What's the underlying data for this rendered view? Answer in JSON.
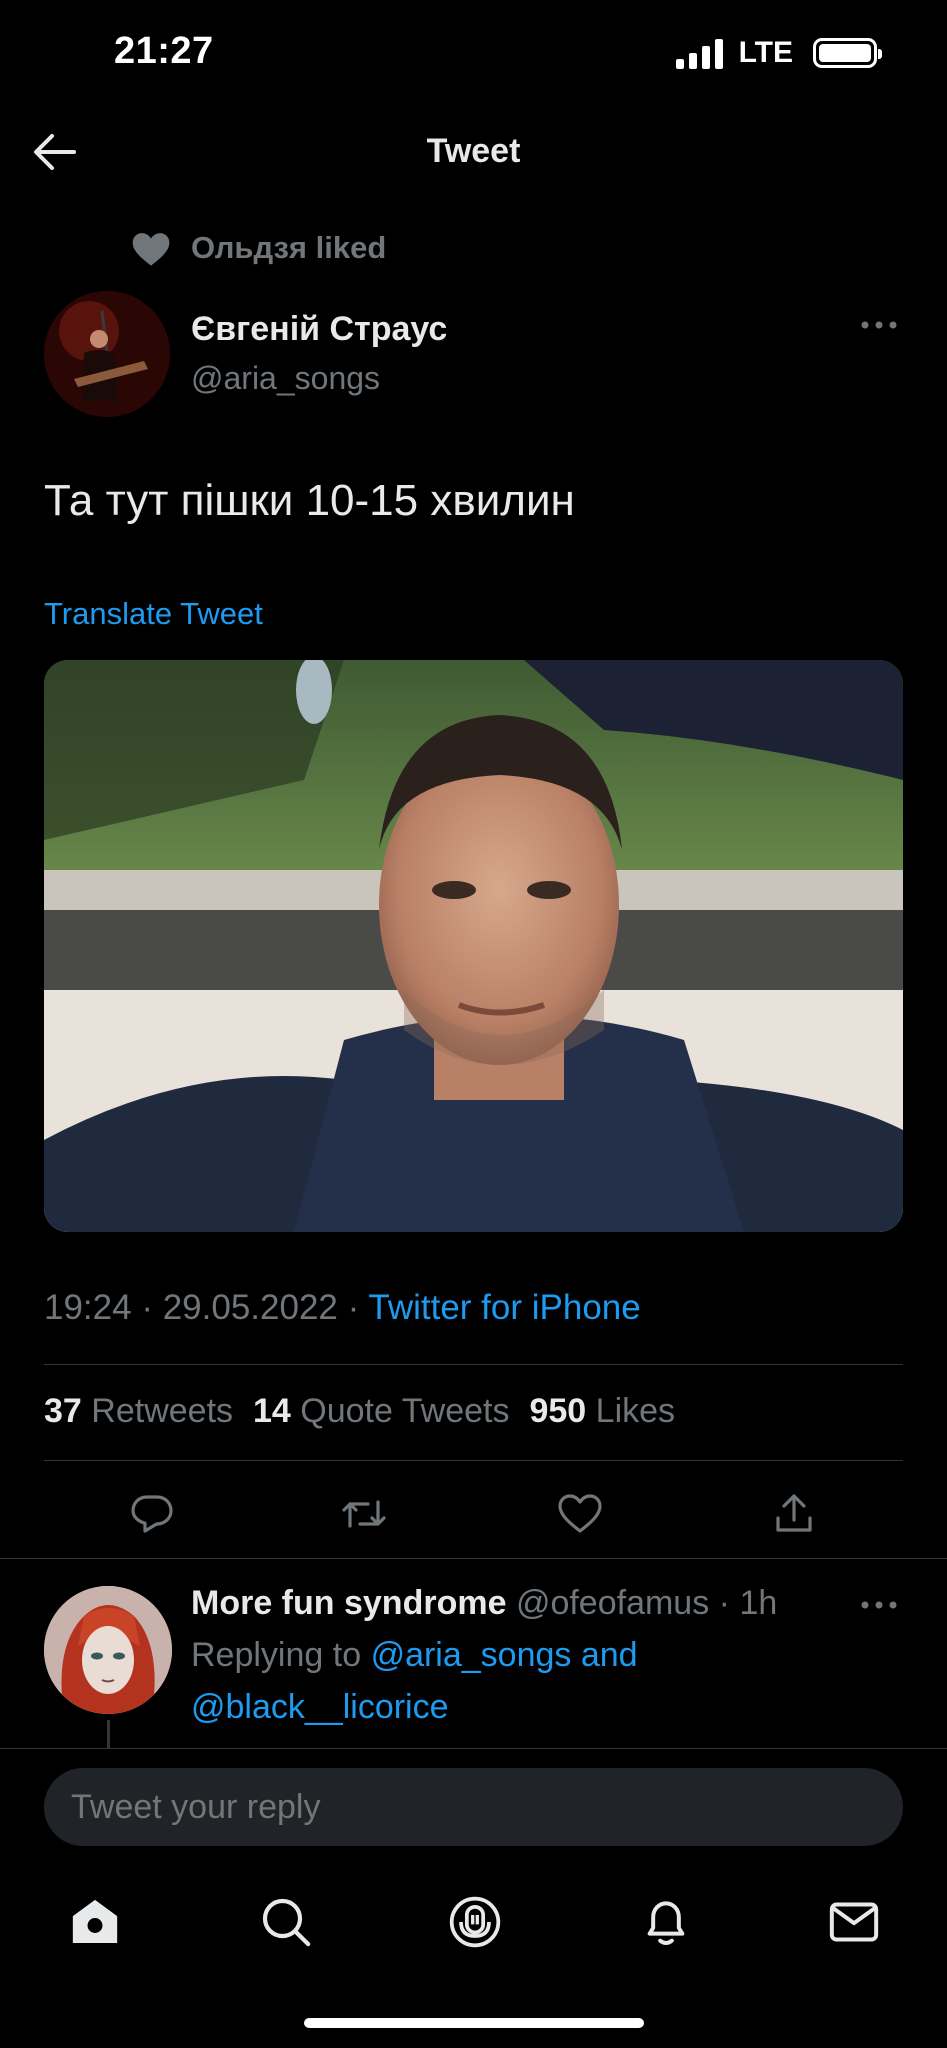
{
  "status_bar": {
    "time": "21:27",
    "network": "LTE"
  },
  "header": {
    "title": "Tweet"
  },
  "social_context": {
    "text": "Ольдзя liked"
  },
  "tweet": {
    "author_name": "Євгеній Страус",
    "author_handle": "@aria_songs",
    "text": "Та тут пішки 10-15 хвилин",
    "translate_label": "Translate Tweet",
    "time": "19:24",
    "date": "29.05.2022",
    "source": "Twitter for iPhone",
    "retweets_count": "37",
    "retweets_label": "Retweets",
    "quote_count": "14",
    "quote_label": "Quote Tweets",
    "likes_count": "950",
    "likes_label": "Likes"
  },
  "reply": {
    "name": "More fun syndrome",
    "handle": "@ofeofamus",
    "age": "1h",
    "replying_prefix": "Replying to",
    "replying_to_1": "@aria_songs and",
    "replying_to_2": "@black__licorice"
  },
  "compose": {
    "placeholder": "Tweet your reply"
  },
  "icons": {
    "back": "arrow-left-icon",
    "liked": "heart-filled-icon",
    "more": "more-horizontal-icon",
    "actions": [
      "reply-icon",
      "retweet-icon",
      "like-icon",
      "share-icon"
    ],
    "nav": [
      "home-icon",
      "search-icon",
      "spaces-icon",
      "notifications-icon",
      "messages-icon"
    ]
  },
  "colors": {
    "background": "#000000",
    "text": "#e7e9ea",
    "muted": "#71767b",
    "link": "#1d9bf0",
    "divider": "#2f3336"
  }
}
